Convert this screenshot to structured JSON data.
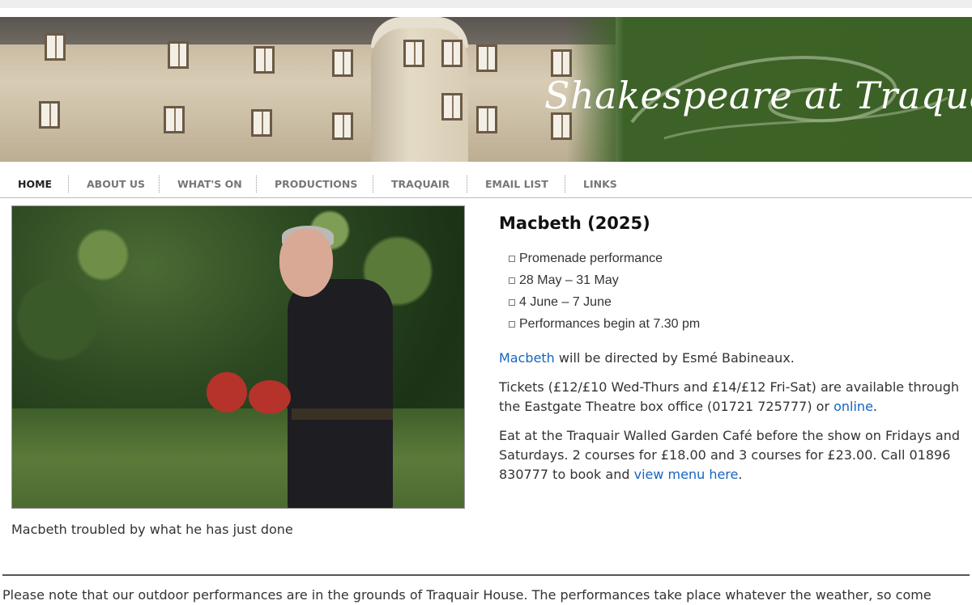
{
  "banner": {
    "title": "Shakespeare at Traquair"
  },
  "nav": {
    "items": [
      {
        "label": "HOME"
      },
      {
        "label": "ABOUT US"
      },
      {
        "label": "WHAT'S ON"
      },
      {
        "label": "PRODUCTIONS"
      },
      {
        "label": "TRAQUAIR"
      },
      {
        "label": "EMAIL LIST"
      },
      {
        "label": "LINKS"
      }
    ],
    "active": "HOME"
  },
  "photo": {
    "caption": "Macbeth troubled by what he has just done"
  },
  "production": {
    "title": "Macbeth (2025)",
    "details": [
      "Promenade performance",
      "28 May – 31 May",
      "4 June – 7 June",
      "Performances begin at 7.30 pm"
    ],
    "director": {
      "link": "Macbeth",
      "text": " will be directed by Esmé Babineaux."
    },
    "tickets": {
      "text": "Tickets (£12/£10 Wed-Thurs and £14/£12 Fri-Sat) are available through the Eastgate Theatre box office (01721 725777) or ",
      "link": "online",
      "after": "."
    },
    "cafe": {
      "text": "Eat at the Traquair Walled Garden Café before the show on Fridays and Saturdays. 2 courses for £18.00 and 3 courses for £23.00. Call 01896 830777 to book and ",
      "link": "view menu here",
      "after": "."
    }
  },
  "notice": "Please note that our outdoor performances are in the grounds of Traquair House. The performances take place whatever the weather, so come",
  "colors": {
    "banner_green": "#3d6227",
    "link": "#1565c0"
  }
}
